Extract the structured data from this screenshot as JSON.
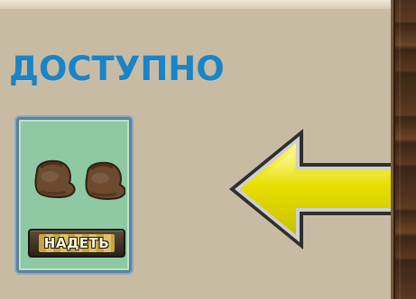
{
  "screen": {
    "section_title": "ДОСТУПНО"
  },
  "item": {
    "icon": "boots-icon",
    "action_label": "НАДЕТЬ"
  },
  "pointer": {
    "icon": "yellow-arrow-left-icon",
    "color": "#e6de00"
  },
  "colors": {
    "panel_bg": "#c8bba4",
    "title_blue": "#1a84c7",
    "card_green": "#8fc9a3",
    "card_border": "#5b82a0"
  }
}
